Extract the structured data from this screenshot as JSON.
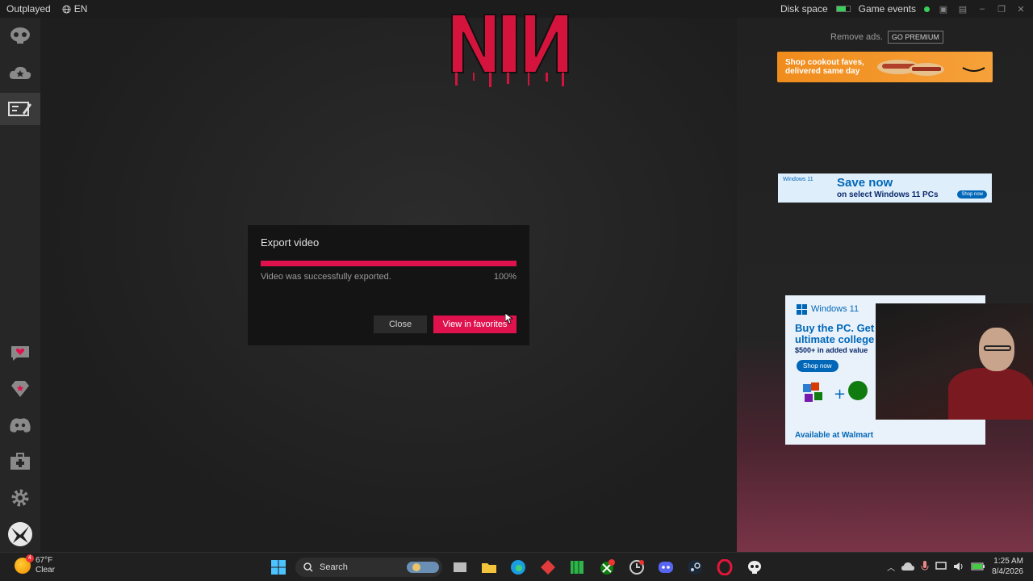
{
  "titlebar": {
    "app_name": "Outplayed",
    "language": "EN",
    "disk_space_label": "Disk space",
    "disk_space_fill_percent": 70,
    "game_events_label": "Game events"
  },
  "sidebar": {
    "items": [
      {
        "name": "home",
        "icon": "skull-icon"
      },
      {
        "name": "cloud",
        "icon": "cloud-star-icon"
      },
      {
        "name": "editor",
        "icon": "clip-editor-icon"
      },
      {
        "name": "favorites",
        "icon": "heart-chat-icon"
      },
      {
        "name": "premium",
        "icon": "gem-icon"
      },
      {
        "name": "discord",
        "icon": "discord-icon"
      },
      {
        "name": "support",
        "icon": "medkit-icon"
      },
      {
        "name": "settings",
        "icon": "gear-icon"
      },
      {
        "name": "profile",
        "icon": "avatar"
      }
    ]
  },
  "ads": {
    "remove_ads": "Remove ads.",
    "go_premium": "GO PREMIUM",
    "ad1_text": "Shop cookout faves, delivered same day",
    "ad2_brand": "Windows 11",
    "ad2_headline": "Save now",
    "ad2_sub": "on select Windows 11 PCs",
    "ad2_cta": "Shop now",
    "ad3_brand": "Windows 11",
    "ad3_headline": "Buy the PC. Get ultimate college",
    "ad3_sub": "$500+ in added value",
    "ad3_cta": "Shop now",
    "ad3_footer": "Available at Walmart"
  },
  "dialog": {
    "title": "Export video",
    "progress_percent": 100,
    "status": "Video was successfully exported.",
    "percent_label": "100%",
    "close_label": "Close",
    "view_favorites_label": "View in favorites"
  },
  "taskbar": {
    "temperature": "67°F",
    "condition": "Clear",
    "weather_badge": "4",
    "search_label": "Search",
    "time": "1:25 AM",
    "date": "8/4/2026"
  },
  "colors": {
    "accent": "#e0124e",
    "sidebar_bg": "#262626",
    "dialog_bg": "#141414"
  }
}
